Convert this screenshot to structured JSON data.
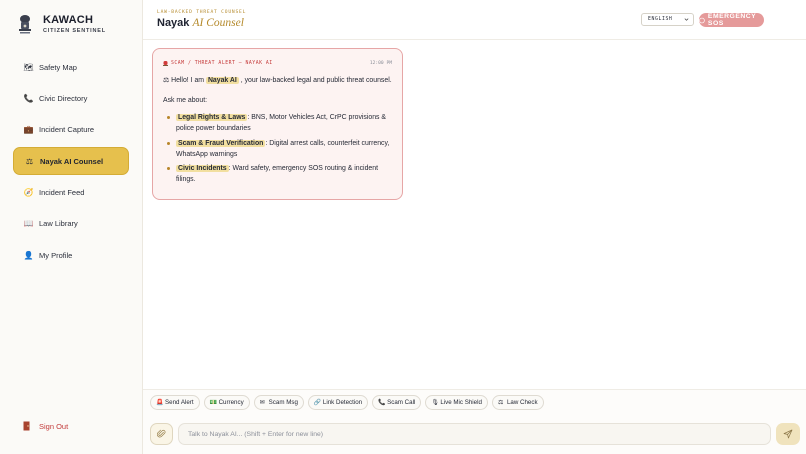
{
  "brand": {
    "name": "KAWACH",
    "subtitle": "CITIZEN SENTINEL"
  },
  "sidebar": {
    "items": [
      {
        "label": "Safety Map",
        "icon": "map-icon",
        "glyph": "🗺"
      },
      {
        "label": "Civic Directory",
        "icon": "phone-icon",
        "glyph": "📞"
      },
      {
        "label": "Incident Capture",
        "icon": "briefcase-icon",
        "glyph": "💼"
      },
      {
        "label": "Nayak AI Counsel",
        "icon": "scales-icon",
        "glyph": "⚖",
        "active": true
      },
      {
        "label": "Incident Feed",
        "icon": "compass-icon",
        "glyph": "🧭"
      },
      {
        "label": "Law Library",
        "icon": "book-icon",
        "glyph": "📖"
      },
      {
        "label": "My Profile",
        "icon": "user-icon",
        "glyph": "👤"
      }
    ],
    "signout": "Sign Out"
  },
  "header": {
    "kicker": "LAW-BACKED THREAT COUNSEL",
    "title_main": "Nayak",
    "title_accent": "AI Counsel",
    "language": "ENGLISH",
    "sos": "EMERGENCY SOS"
  },
  "message": {
    "tag": "SCAM / THREAT ALERT — NAYAK AI",
    "time": "12:00 PM",
    "greeting_pre": "⚖ Hello! I am",
    "greeting_name": "Nayak AI",
    "greeting_post": ", your law-backed legal and public threat counsel.",
    "ask": "Ask me about:",
    "topics": [
      {
        "title": "Legal Rights & Laws",
        "text": ": BNS, Motor Vehicles Act, CrPC provisions & police power boundaries"
      },
      {
        "title": "Scam & Fraud Verification",
        "text": ": Digital arrest calls, counterfeit currency, WhatsApp warnings"
      },
      {
        "title": "Civic Incidents",
        "text": ": Ward safety, emergency SOS routing & incident filings."
      }
    ]
  },
  "quick_actions": [
    {
      "label": "Send Alert",
      "icon": "alarm-icon",
      "glyph": "🚨"
    },
    {
      "label": "Currency",
      "icon": "banknote-icon",
      "glyph": "💵"
    },
    {
      "label": "Scam Msg",
      "icon": "message-icon",
      "glyph": "✉"
    },
    {
      "label": "Link Detection",
      "icon": "link-icon",
      "glyph": "🔗"
    },
    {
      "label": "Scam Call",
      "icon": "phone-icon",
      "glyph": "📞"
    },
    {
      "label": "Live Mic Shield",
      "icon": "mic-icon",
      "glyph": "🎙"
    },
    {
      "label": "Law Check",
      "icon": "scales-icon",
      "glyph": "⚖"
    }
  ],
  "composer": {
    "placeholder": "Talk to Nayak AI... (Shift + Enter for new line)"
  },
  "colors": {
    "accent": "#e6c04d",
    "danger": "#c53a3a",
    "sos_bg": "#e59a9a",
    "card_bg": "#fdf3f2"
  }
}
